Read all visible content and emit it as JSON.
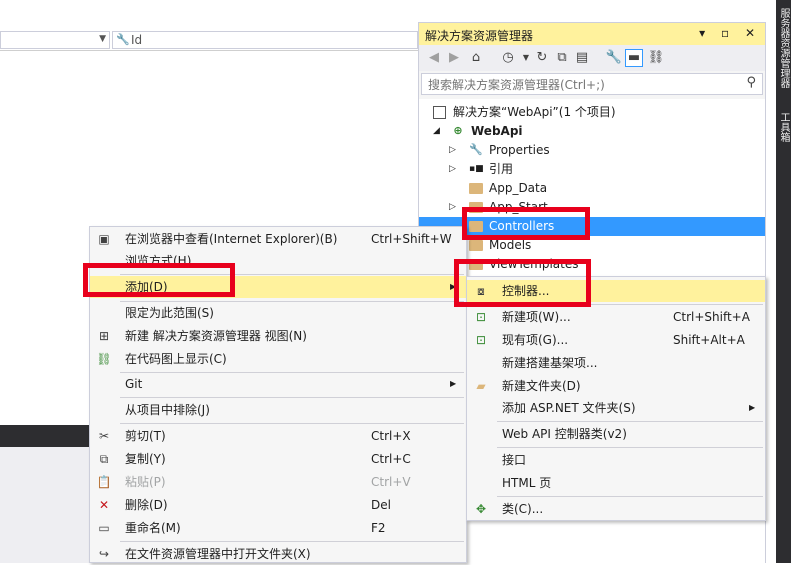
{
  "left_panel": {
    "props_combo_value": "",
    "props_id_placeholder": "Id"
  },
  "vertical_tabs": [
    "服务器资源管理器",
    "工具箱"
  ],
  "solution_explorer": {
    "title": "解决方案资源管理器",
    "title_buttons": "▾ ▫ ✕",
    "search_placeholder": "搜索解决方案资源管理器(Ctrl+;)",
    "tree": [
      {
        "label": "解决方案“WebApi”(1 个项目)",
        "icon": "solution-icon"
      },
      {
        "label": "WebApi",
        "icon": "web-project-icon",
        "bold": true
      },
      {
        "label": "Properties",
        "icon": "wrench-icon"
      },
      {
        "label": "引用",
        "icon": "references-icon"
      },
      {
        "label": "App_Data",
        "icon": "folder-icon"
      },
      {
        "label": "App_Start",
        "icon": "folder-icon"
      },
      {
        "label": "Controllers",
        "icon": "folder-icon",
        "selected": true
      },
      {
        "label": "Models",
        "icon": "folder-icon"
      },
      {
        "label": "ViewTemplates",
        "icon": "folder-icon"
      }
    ]
  },
  "context_menu": {
    "items": [
      {
        "label": "在浏览器中查看(Internet Explorer)(B)",
        "shortcut": "Ctrl+Shift+W",
        "icon": "browser-icon"
      },
      {
        "label": "浏览方式(H)...",
        "shortcut": ""
      },
      {
        "label": "添加(D)",
        "shortcut": "",
        "submenu": true
      },
      {
        "label": "限定为此范围(S)",
        "shortcut": ""
      },
      {
        "label": "新建 解决方案资源管理器 视图(N)",
        "shortcut": "",
        "icon": "new-view-icon"
      },
      {
        "label": "在代码图上显示(C)",
        "shortcut": "",
        "icon": "code-map-icon"
      },
      {
        "label": "Git",
        "shortcut": "",
        "submenu": true
      },
      {
        "label": "从项目中排除(J)",
        "shortcut": ""
      },
      {
        "label": "剪切(T)",
        "shortcut": "Ctrl+X",
        "icon": "cut-icon"
      },
      {
        "label": "复制(Y)",
        "shortcut": "Ctrl+C",
        "icon": "copy-icon"
      },
      {
        "label": "粘贴(P)",
        "shortcut": "Ctrl+V",
        "icon": "paste-icon",
        "disabled": true
      },
      {
        "label": "删除(D)",
        "shortcut": "Del",
        "icon": "delete-icon"
      },
      {
        "label": "重命名(M)",
        "shortcut": "F2",
        "icon": "rename-icon"
      },
      {
        "label": "在文件资源管理器中打开文件夹(X)",
        "shortcut": "",
        "icon": "open-folder-icon"
      }
    ]
  },
  "add_submenu": {
    "items": [
      {
        "label": "控制器...",
        "shortcut": "",
        "icon": "controller-icon"
      },
      {
        "label": "新建项(W)...",
        "shortcut": "Ctrl+Shift+A",
        "icon": "new-item-icon"
      },
      {
        "label": "现有项(G)...",
        "shortcut": "Shift+Alt+A",
        "icon": "existing-item-icon"
      },
      {
        "label": "新建搭建基架项...",
        "shortcut": ""
      },
      {
        "label": "新建文件夹(D)",
        "shortcut": "",
        "icon": "new-folder-icon"
      },
      {
        "label": "添加 ASP.NET 文件夹(S)",
        "shortcut": "",
        "submenu": true
      },
      {
        "label": "Web API 控制器类(v2)",
        "shortcut": ""
      },
      {
        "label": "接口",
        "shortcut": ""
      },
      {
        "label": "HTML 页",
        "shortcut": ""
      },
      {
        "label": "类(C)...",
        "shortcut": "",
        "icon": "class-icon"
      }
    ]
  },
  "colors": {
    "highlight": "#fff29d",
    "selection": "#3399ff",
    "annotation_red": "#e8001c",
    "dark_chrome": "#2d2d30"
  }
}
